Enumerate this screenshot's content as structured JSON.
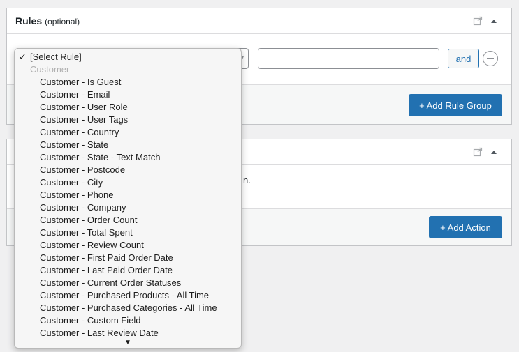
{
  "rules_panel": {
    "title": "Rules",
    "optional": "(optional)",
    "and_label": "and",
    "add_group_label": "+ Add Rule Group"
  },
  "actions_panel": {
    "partial_text": "n.",
    "add_action_label": "+ Add Action"
  },
  "dropdown": {
    "selected": "[Select Rule]",
    "check": "✓",
    "group": "Customer",
    "options": [
      "Customer - Is Guest",
      "Customer - Email",
      "Customer - User Role",
      "Customer - User Tags",
      "Customer - Country",
      "Customer - State",
      "Customer - State - Text Match",
      "Customer - Postcode",
      "Customer - City",
      "Customer - Phone",
      "Customer - Company",
      "Customer - Order Count",
      "Customer - Total Spent",
      "Customer - Review Count",
      "Customer - First Paid Order Date",
      "Customer - Last Paid Order Date",
      "Customer - Current Order Statuses",
      "Customer - Purchased Products - All Time",
      "Customer - Purchased Categories - All Time",
      "Customer - Custom Field",
      "Customer - Last Review Date"
    ],
    "scroll_down": "▼"
  },
  "colors": {
    "primary": "#2271b1",
    "background": "#f0f0f1"
  }
}
